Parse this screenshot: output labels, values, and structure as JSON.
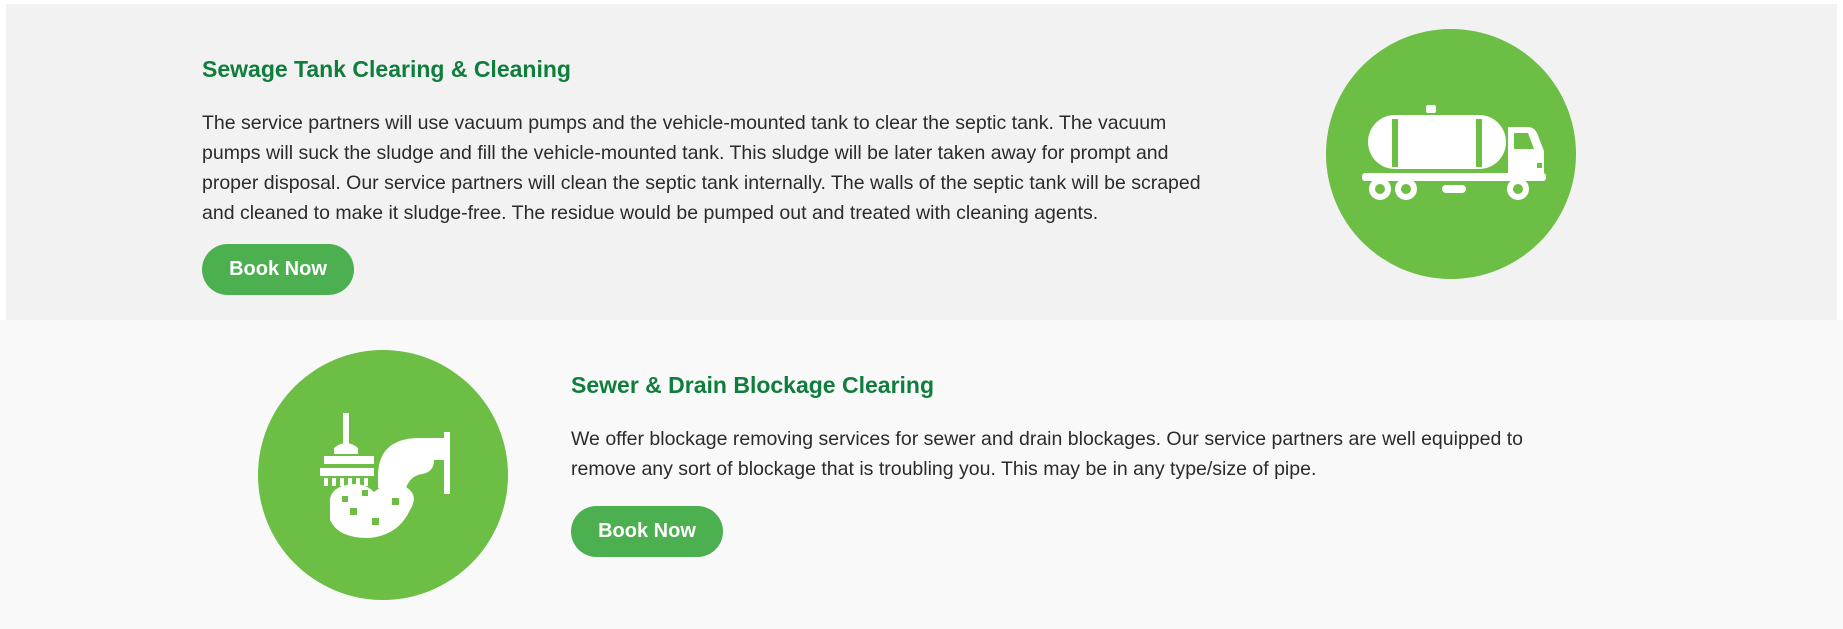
{
  "services": [
    {
      "title": "Sewage Tank Clearing & Cleaning",
      "description": "The service partners will use vacuum pumps and the vehicle-mounted tank to clear the septic tank. The vacuum pumps will suck the sludge and fill the vehicle-mounted tank. This sludge will be later taken away for prompt and proper disposal. Our service partners will clean the septic tank internally. The walls of the septic tank will be scraped and cleaned to make it sludge-free. The residue would be pumped out and treated with cleaning agents.",
      "button_label": "Book Now",
      "icon": "tanker-truck-icon"
    },
    {
      "title": "Sewer & Drain Blockage Clearing",
      "description": "We offer blockage removing services for sewer and drain blockages. Our service partners are well equipped to remove any sort of blockage that is troubling you. This may be in any type/size of pipe.",
      "button_label": "Book Now",
      "icon": "drain-plunger-icon"
    }
  ],
  "colors": {
    "title_green": "#0f7e3c",
    "button_green": "#4caf50",
    "circle_green": "#6dbe45",
    "section_1_bg": "#f2f2f2",
    "section_2_bg": "#f9f9f9",
    "body_text": "#2b2b2b"
  }
}
